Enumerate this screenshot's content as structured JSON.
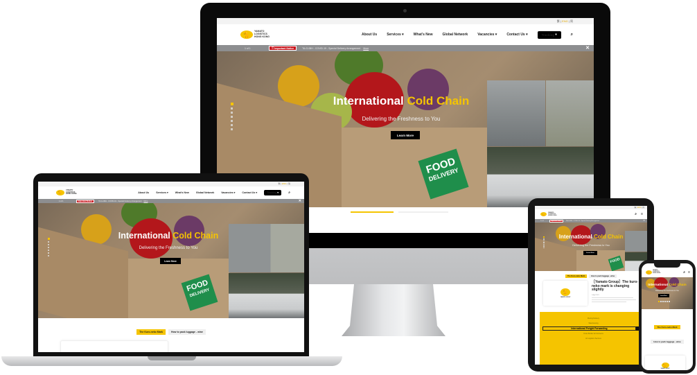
{
  "site": {
    "logo_lines": [
      "YAMATO",
      "LOGISTICS",
      "HONG KONG"
    ],
    "lang_switch": [
      "繁",
      "ENG",
      "简"
    ],
    "nav": [
      {
        "label": "About Us",
        "has_dropdown": false
      },
      {
        "label": "Services",
        "has_dropdown": true
      },
      {
        "label": "What's New",
        "has_dropdown": false
      },
      {
        "label": "Global Network",
        "has_dropdown": false
      },
      {
        "label": "Vacancies",
        "has_dropdown": true
      },
      {
        "label": "Contact Us",
        "has_dropdown": true
      }
    ],
    "tracking_label": "Tracking",
    "search_icon": "search-icon",
    "menu_icon": "hamburger-icon",
    "notice": {
      "counter": "1 of 1",
      "badge": "Important Notice",
      "text": "TA-G-08H - COVID-19 - Special Delivery Arrangement",
      "more": "More",
      "close": "✕"
    },
    "hero": {
      "title_white": "International",
      "title_yellow": "Cold Chain",
      "subtitle": "Delivering the Freshness to You",
      "cta": "Learn More",
      "box_text_1": "FOOD",
      "box_text_2": "DELIVERY",
      "slides_total": 7,
      "active_slide": 1
    },
    "tabs": [
      "The Kuro-neko Mark",
      "How to pack luggage - wine"
    ],
    "news": {
      "title": "［Yamato Group］The kuro-neko mark is changing slightly",
      "date": "1 April 2021",
      "logo_caption": "YAMATO GROUP"
    },
    "services_menu": {
      "items": [
        "Moving Delivery",
        "Warehousing",
        "International Freight Forwarding",
        "Cross Border E-Commerce",
        "Air Logistics Services"
      ],
      "active": "International Freight Forwarding",
      "go": "GO"
    }
  },
  "colors": {
    "brand_yellow": "#f5c400",
    "notice_red": "#c8161d",
    "notice_bar": "#8d8e90",
    "black": "#000000"
  }
}
